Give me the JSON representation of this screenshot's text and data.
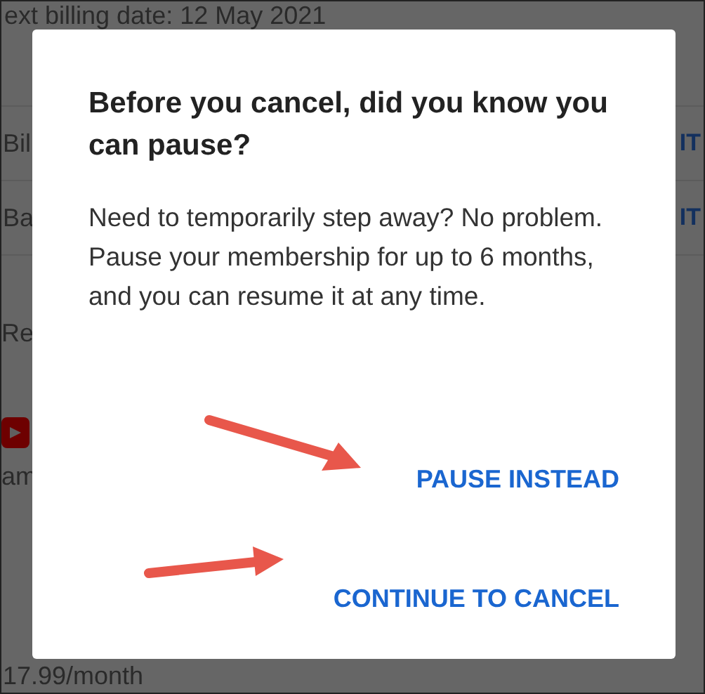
{
  "background": {
    "billing_date": "ext billing date: 12 May 2021",
    "rows": [
      {
        "label": "Bil",
        "action": "IT"
      },
      {
        "label": "Ba",
        "action": "IT"
      }
    ],
    "section_label": "Re",
    "plan_name": "am",
    "plan_price": "17.99/month"
  },
  "dialog": {
    "title": "Before you cancel, did you know you can pause?",
    "body": "Need to temporarily step away? No problem. Pause your membership for up to 6 months, and you can resume it at any time.",
    "buttons": [
      {
        "label": "PAUSE INSTEAD",
        "arrow": true
      },
      {
        "label": "CONTINUE TO CANCEL",
        "arrow": true
      }
    ]
  }
}
